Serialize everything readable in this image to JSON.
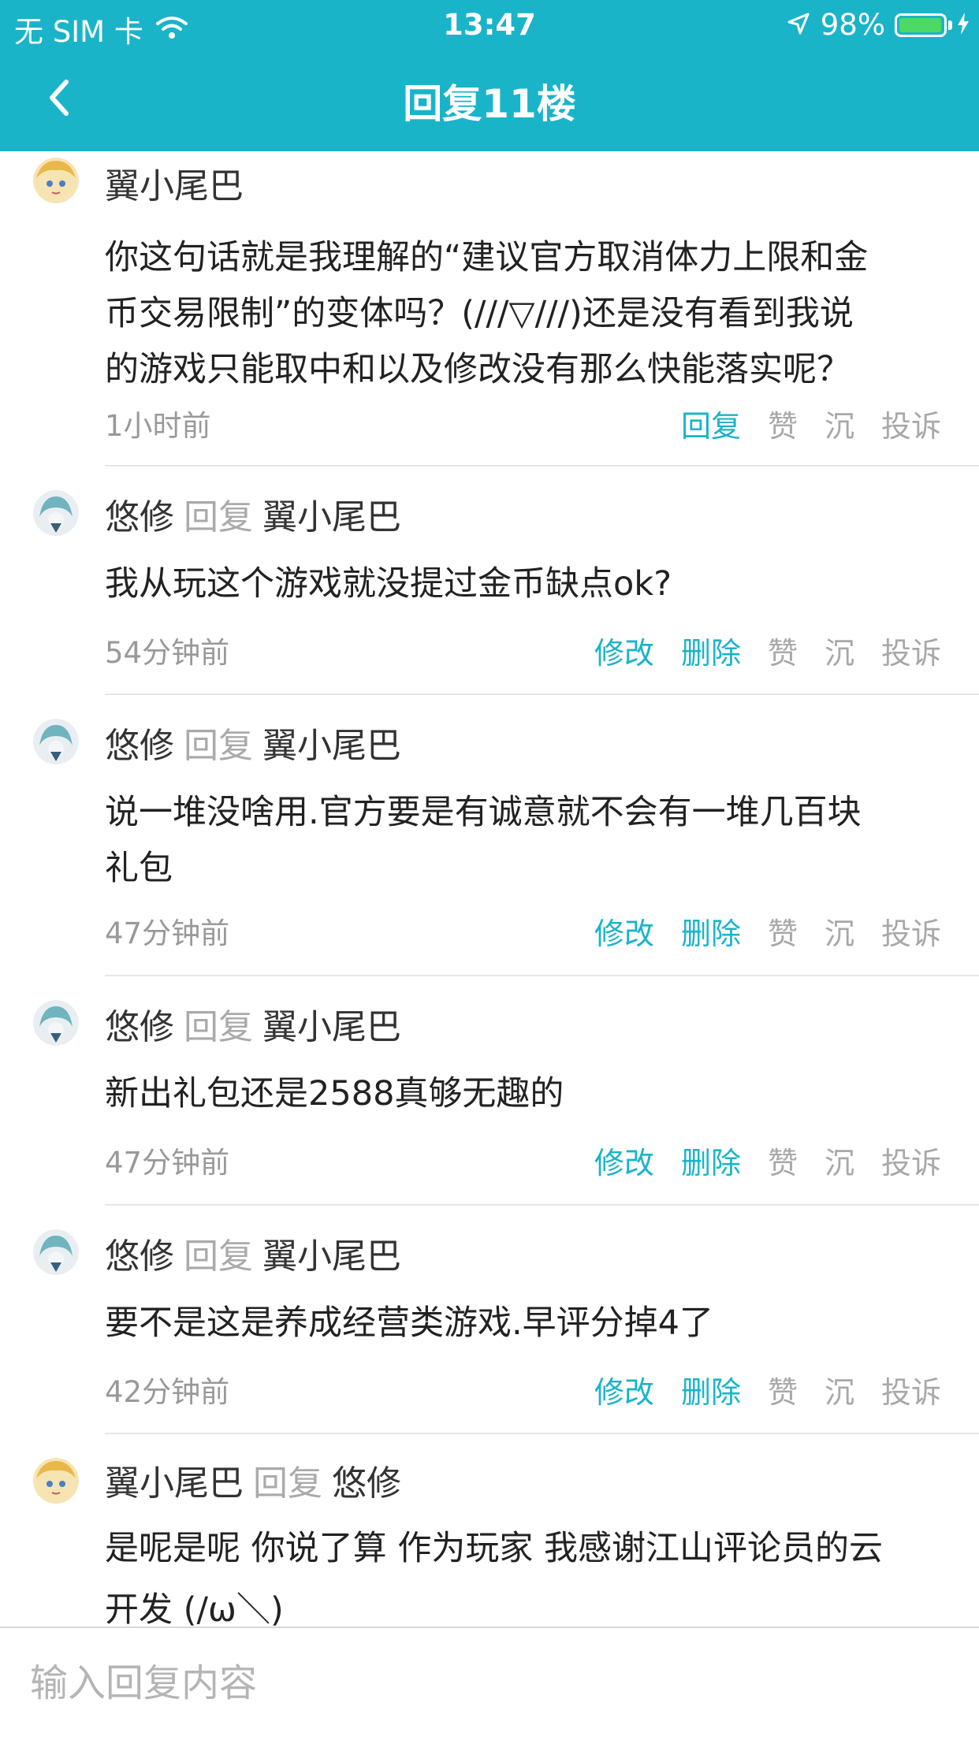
{
  "status_bar": {
    "carrier": "无 SIM 卡",
    "time": "13:47",
    "battery": "98%",
    "battery_level": 0.98
  },
  "nav": {
    "title": "回复11楼",
    "back_icon": "chevron-left-icon"
  },
  "colors": {
    "accent": "#1ab4c9",
    "muted": "#aaaaaa",
    "text": "#222222"
  },
  "comments": [
    {
      "author": "翼小尾巴",
      "reply_word": "",
      "target": "",
      "lines": [
        "你这句话就是我理解的“建议官方取消体力上限和金",
        "币交易限制”的变体吗？(///▽///)还是没有看到我说",
        "的游戏只能取中和以及修改没有那么快能落实呢？"
      ],
      "time": "1小时前",
      "actions": [
        "回复",
        "赞",
        "沉",
        "投诉"
      ]
    },
    {
      "author": "悠修",
      "reply_word": "回复",
      "target": "翼小尾巴",
      "lines": [
        "我从玩这个游戏就没提过金币缺点ok?"
      ],
      "time": "54分钟前",
      "actions": [
        "修改",
        "删除",
        "赞",
        "沉",
        "投诉"
      ]
    },
    {
      "author": "悠修",
      "reply_word": "回复",
      "target": "翼小尾巴",
      "lines": [
        "说一堆没啥用.官方要是有诚意就不会有一堆几百块",
        "礼包"
      ],
      "time": "47分钟前",
      "actions": [
        "修改",
        "删除",
        "赞",
        "沉",
        "投诉"
      ]
    },
    {
      "author": "悠修",
      "reply_word": "回复",
      "target": "翼小尾巴",
      "lines": [
        "新出礼包还是2588真够无趣的"
      ],
      "time": "47分钟前",
      "actions": [
        "修改",
        "删除",
        "赞",
        "沉",
        "投诉"
      ]
    },
    {
      "author": "悠修",
      "reply_word": "回复",
      "target": "翼小尾巴",
      "lines": [
        "要不是这是养成经营类游戏.早评分掉4了"
      ],
      "time": "42分钟前",
      "actions": [
        "修改",
        "删除",
        "赞",
        "沉",
        "投诉"
      ]
    },
    {
      "author": "翼小尾巴",
      "reply_word": "回复",
      "target": "悠修",
      "lines": [
        "是呢是呢 你说了算 作为玩家 我感谢江山评论员的云",
        "开发 (/ω＼)"
      ],
      "time": "",
      "actions": []
    }
  ],
  "input": {
    "placeholder": "输入回复内容"
  }
}
